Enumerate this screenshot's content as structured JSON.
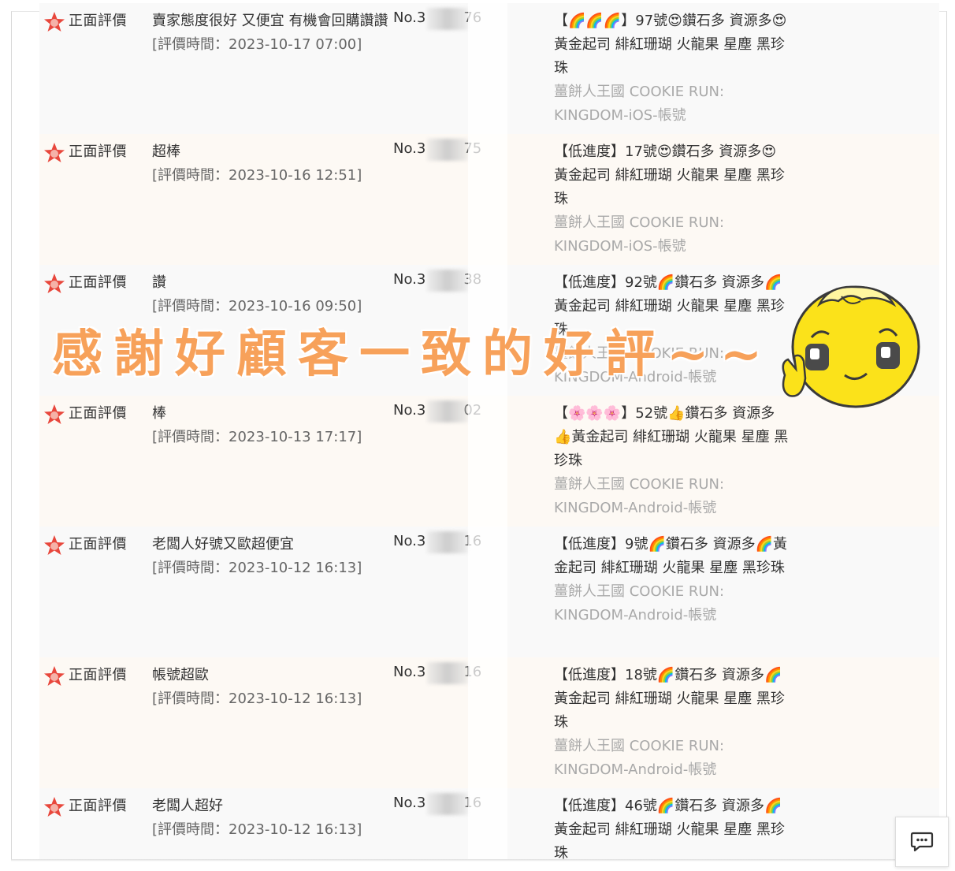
{
  "overlay": {
    "text": "感謝好顧客一致的好評~~"
  },
  "reviews": [
    {
      "type": "正面評價",
      "comment": "賣家態度很好 又便宜 有機會回購讚讚",
      "time": "[評價時間：2023-10-17 07:00]",
      "order_prefix": "No.3",
      "order_suffix": "76",
      "product": "【🌈🌈🌈】97號😍鑽石多 資源多😍黃金起司 緋紅珊瑚 火龍果 星塵 黑珍珠",
      "category": "薑餅人王國 COOKIE RUN: KINGDOM-iOS-帳號"
    },
    {
      "type": "正面評價",
      "comment": "超棒",
      "time": "[評價時間：2023-10-16 12:51]",
      "order_prefix": "No.3",
      "order_suffix": "75",
      "product": "【低進度】17號😍鑽石多 資源多😍黃金起司 緋紅珊瑚 火龍果 星塵 黑珍珠",
      "category": "薑餅人王國 COOKIE RUN: KINGDOM-iOS-帳號"
    },
    {
      "type": "正面評價",
      "comment": "讚",
      "time": "[評價時間：2023-10-16 09:50]",
      "order_prefix": "No.3",
      "order_suffix": "38",
      "product": "【低進度】92號🌈鑽石多 資源多🌈黃金起司 緋紅珊瑚 火龍果 星塵 黑珍珠",
      "category": "薑餅人王國 COOKIE RUN: KINGDOM-Android-帳號"
    },
    {
      "type": "正面評價",
      "comment": "棒",
      "time": "[評價時間：2023-10-13 17:17]",
      "order_prefix": "No.3",
      "order_suffix": "02",
      "product": "【🌸🌸🌸】52號👍鑽石多 資源多👍黃金起司 緋紅珊瑚 火龍果 星塵 黑珍珠",
      "category": "薑餅人王國 COOKIE RUN: KINGDOM-Android-帳號"
    },
    {
      "type": "正面評價",
      "comment": "老闆人好號又歐超便宜",
      "time": "[評價時間：2023-10-12 16:13]",
      "order_prefix": "No.3",
      "order_suffix": "16",
      "product": "【低進度】9號🌈鑽石多 資源多🌈黃金起司 緋紅珊瑚 火龍果 星塵 黑珍珠",
      "category": "薑餅人王國 COOKIE RUN: KINGDOM-Android-帳號"
    },
    {
      "type": "正面評價",
      "comment": "帳號超歐",
      "time": "[評價時間：2023-10-12 16:13]",
      "order_prefix": "No.3",
      "order_suffix": "16",
      "product": "【低進度】18號🌈鑽石多 資源多🌈黃金起司 緋紅珊瑚 火龍果 星塵 黑珍珠",
      "category": "薑餅人王國 COOKIE RUN: KINGDOM-Android-帳號"
    },
    {
      "type": "正面評價",
      "comment": "老闆人超好",
      "time": "[評價時間：2023-10-12 16:13]",
      "order_prefix": "No.3",
      "order_suffix": "16",
      "product": "【低進度】46號🌈鑽石多 資源多🌈黃金起司 緋紅珊瑚 火龍果 星塵 黑珍珠",
      "category": ""
    }
  ],
  "icons": {
    "rating": "star-flower-icon",
    "chat": "chat-bubble-icon",
    "mascot": "yellow-face-mascot"
  },
  "colors": {
    "overlay": "#f7a15a",
    "star": "#e8473c",
    "category": "#a9a9a9"
  }
}
